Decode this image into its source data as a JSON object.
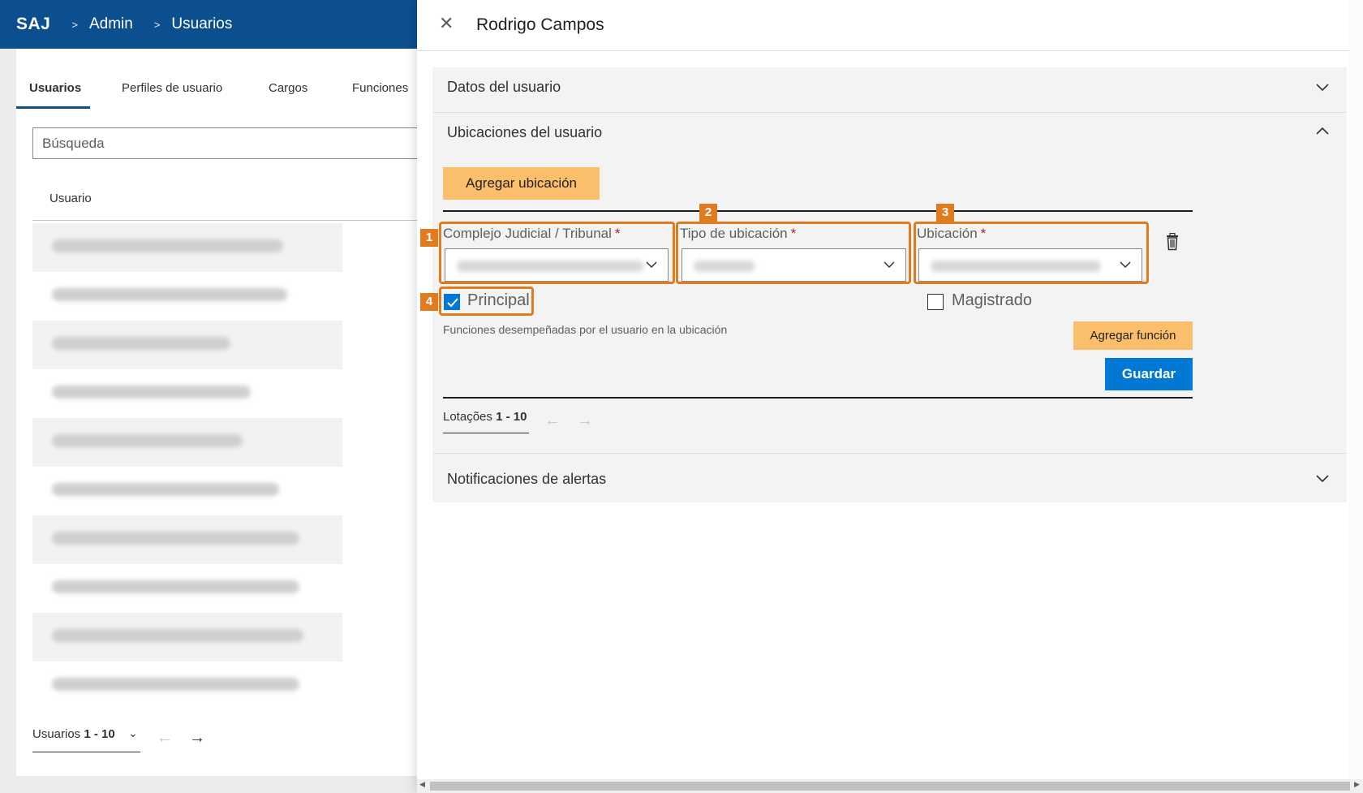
{
  "app": {
    "logo": "SAJ",
    "breadcrumb": [
      "Admin",
      "Usuarios"
    ]
  },
  "tabs": [
    "Usuarios",
    "Perfiles de usuario",
    "Cargos",
    "Funciones"
  ],
  "search": {
    "placeholder": "Búsqueda"
  },
  "table": {
    "column": "Usuario"
  },
  "pager": {
    "label": "Usuarios",
    "range": "1 - 10"
  },
  "panel": {
    "title": "Rodrigo Campos",
    "sections": {
      "datos": "Datos del usuario",
      "ubicaciones": "Ubicaciones del usuario",
      "notificaciones": "Notificaciones de alertas"
    },
    "add_location": "Agregar ubicación",
    "fields": {
      "complejo": "Complejo Judicial / Tribunal",
      "tipo": "Tipo de ubicación",
      "ubicacion": "Ubicación",
      "required": "*"
    },
    "checkboxes": {
      "principal": "Principal",
      "magistrado": "Magistrado"
    },
    "functions_note": "Funciones desempeñadas por el usuario en la ubicación",
    "add_function": "Agregar función",
    "save": "Guardar",
    "lot_pager": {
      "label": "Lotações",
      "range": "1 - 10"
    }
  },
  "badges": [
    "1",
    "2",
    "3",
    "4"
  ],
  "colors": {
    "brand": "#0b4f8e",
    "primary_button": "#0078d4",
    "secondary_button": "#fbbf6b",
    "highlight": "#e07b1f",
    "required": "#a4262c"
  },
  "icons": {
    "close": "close-icon",
    "chevron": "chevron-down-icon",
    "trash": "trash-icon",
    "arrows": "arrow-icon"
  }
}
